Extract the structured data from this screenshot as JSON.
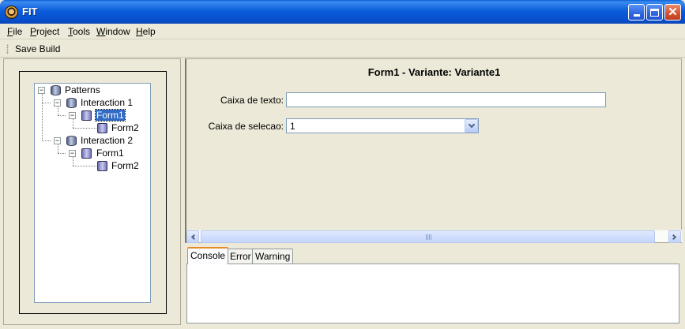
{
  "window": {
    "title": "FIT"
  },
  "menu": {
    "items": [
      {
        "mnemonic": "F",
        "rest": "ile"
      },
      {
        "mnemonic": "P",
        "rest": "roject"
      },
      {
        "mnemonic": "T",
        "rest": "ools"
      },
      {
        "mnemonic": "W",
        "rest": "indow"
      },
      {
        "mnemonic": "H",
        "rest": "elp"
      }
    ]
  },
  "toolbar": {
    "save_build_label": "Save Build"
  },
  "tree": {
    "nodes": [
      {
        "label": "Patterns",
        "icon": "database-icon"
      },
      {
        "label": "Interaction 1",
        "icon": "database-icon"
      },
      {
        "label": "Form1",
        "icon": "form-icon",
        "selected": true
      },
      {
        "label": "Form2",
        "icon": "form-icon"
      },
      {
        "label": "Interaction 2",
        "icon": "database-icon"
      },
      {
        "label": "Form1",
        "icon": "form-icon"
      },
      {
        "label": "Form2",
        "icon": "form-icon"
      }
    ]
  },
  "form": {
    "title": "Form1 - Variante: Variante1",
    "text_field": {
      "label": "Caixa de texto:",
      "value": ""
    },
    "select_field": {
      "label": "Caixa de selecao:",
      "value": "1"
    }
  },
  "console": {
    "tabs": [
      "Console",
      "Error",
      "Warning"
    ],
    "active_tab": "Console"
  },
  "colors": {
    "titlebar": "#0b5ddb",
    "selection": "#316ac5",
    "active_tab_accent": "#e68b2c",
    "window_bg": "#ece9d8"
  }
}
